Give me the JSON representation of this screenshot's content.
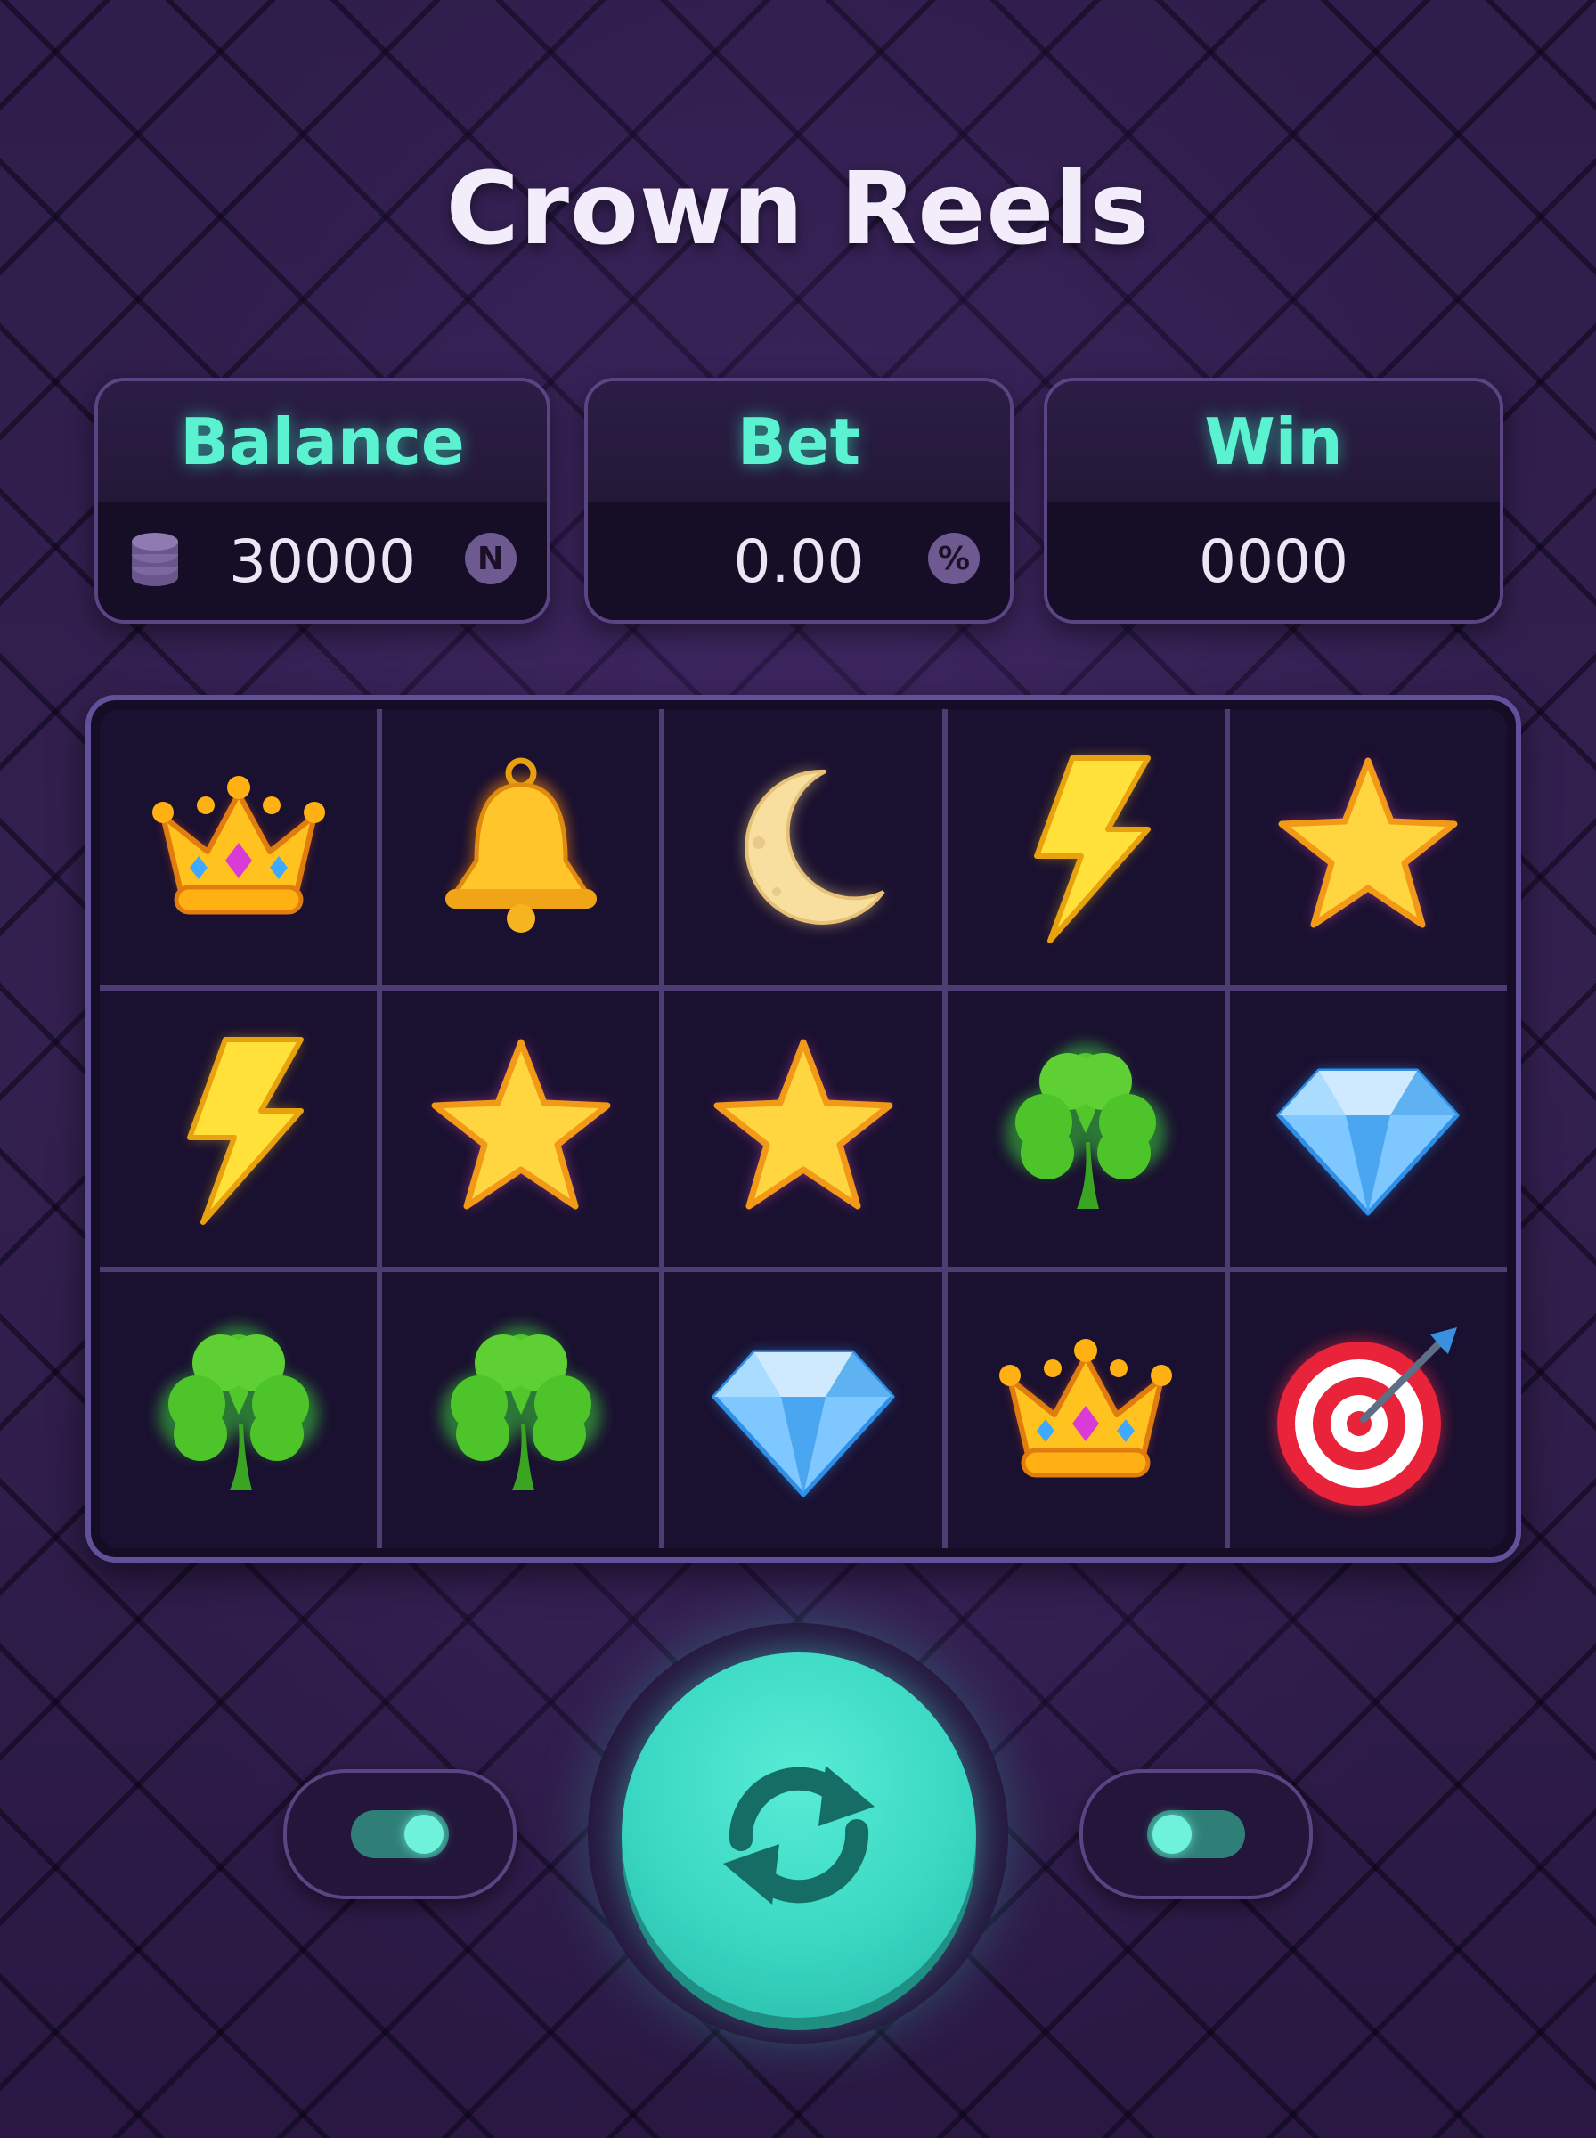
{
  "title": "Crown Reels",
  "stats": {
    "balance": {
      "label": "Balance",
      "value": "30000",
      "badge": "N"
    },
    "bet": {
      "label": "Bet",
      "value": "0.00",
      "badge": "%"
    },
    "win": {
      "label": "Win",
      "value": "0000"
    }
  },
  "reels": [
    [
      "crown",
      "bell",
      "moon",
      "lightning",
      "star"
    ],
    [
      "lightning",
      "star",
      "star",
      "clover",
      "diamond"
    ],
    [
      "clover",
      "clover",
      "diamond",
      "crown",
      "target"
    ]
  ],
  "controls": {
    "left_toggle_on": true,
    "right_toggle_on": false,
    "spin_icon": "refresh-icon"
  },
  "colors": {
    "accent": "#5af2d0",
    "frame": "#63509a",
    "background": "#2c1a45"
  }
}
